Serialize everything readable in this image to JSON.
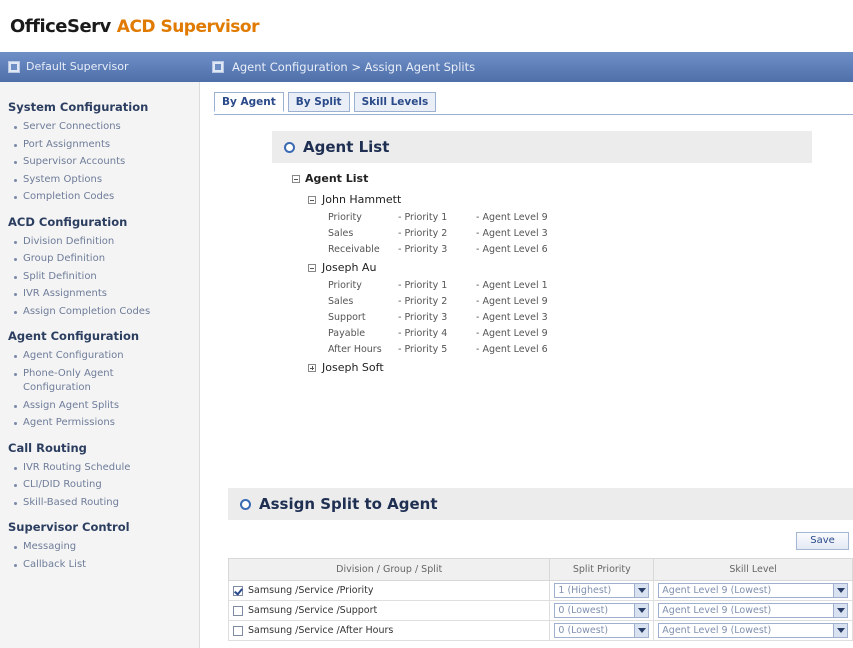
{
  "brand": {
    "name_a": "OfficeServ",
    "name_b": "ACD Supervisor"
  },
  "topbar": {
    "supervisor_label": "Default Supervisor",
    "breadcrumb": "Agent Configuration > Assign Agent Splits"
  },
  "sidebar": {
    "sections": [
      {
        "title": "System Configuration",
        "items": [
          "Server Connections",
          "Port Assignments",
          "Supervisor Accounts",
          "System Options",
          "Completion Codes"
        ]
      },
      {
        "title": "ACD Configuration",
        "items": [
          "Division Definition",
          "Group Definition",
          "Split Definition",
          "IVR Assignments",
          "Assign Completion Codes"
        ]
      },
      {
        "title": "Agent Configuration",
        "items": [
          "Agent Configuration",
          "Phone-Only Agent Configuration",
          "Assign Agent Splits",
          "Agent Permissions"
        ]
      },
      {
        "title": "Call Routing",
        "items": [
          "IVR Routing Schedule",
          "CLI/DID Routing",
          "Skill-Based Routing"
        ]
      },
      {
        "title": "Supervisor Control",
        "items": [
          "Messaging",
          "Callback List"
        ]
      }
    ]
  },
  "tabs": [
    {
      "label": "By Agent",
      "active": true
    },
    {
      "label": "By Split",
      "active": false
    },
    {
      "label": "Skill Levels",
      "active": false
    }
  ],
  "agent_list": {
    "header": "Agent List",
    "root_label": "Agent List",
    "agents": [
      {
        "name": "John Hammett",
        "expanded": true,
        "rows": [
          {
            "split": "Priority",
            "priority": "- Priority 1",
            "level": "- Agent Level 9"
          },
          {
            "split": "Sales",
            "priority": "- Priority 2",
            "level": "- Agent Level 3"
          },
          {
            "split": "Receivable",
            "priority": "- Priority 3",
            "level": "- Agent Level 6"
          }
        ]
      },
      {
        "name": "Joseph Au",
        "expanded": true,
        "rows": [
          {
            "split": "Priority",
            "priority": "- Priority 1",
            "level": "- Agent Level 1"
          },
          {
            "split": "Sales",
            "priority": "- Priority 2",
            "level": "- Agent Level 9"
          },
          {
            "split": "Support",
            "priority": "- Priority 3",
            "level": "- Agent Level 3"
          },
          {
            "split": "Payable",
            "priority": "- Priority 4",
            "level": "- Agent Level 9"
          },
          {
            "split": "After Hours",
            "priority": "- Priority 5",
            "level": "- Agent Level 6"
          }
        ]
      },
      {
        "name": "Joseph Soft",
        "expanded": false,
        "rows": []
      }
    ]
  },
  "assign": {
    "header": "Assign Split to Agent",
    "save_label": "Save",
    "columns": [
      "Division / Group / Split",
      "Split Priority",
      "Skill Level"
    ],
    "rows": [
      {
        "checked": true,
        "split": "Samsung /Service /Priority",
        "priority": "1 (Highest)",
        "skill": "Agent Level 9 (Lowest)"
      },
      {
        "checked": false,
        "split": "Samsung /Service /Support",
        "priority": "0 (Lowest)",
        "skill": "Agent Level 9 (Lowest)"
      },
      {
        "checked": false,
        "split": "Samsung /Service /After Hours",
        "priority": "0 (Lowest)",
        "skill": "Agent Level 9 (Lowest)"
      }
    ]
  },
  "colors": {
    "topbar": "#5a7ab5",
    "brand_accent": "#e07a00",
    "tab_text": "#2a4a8a"
  }
}
